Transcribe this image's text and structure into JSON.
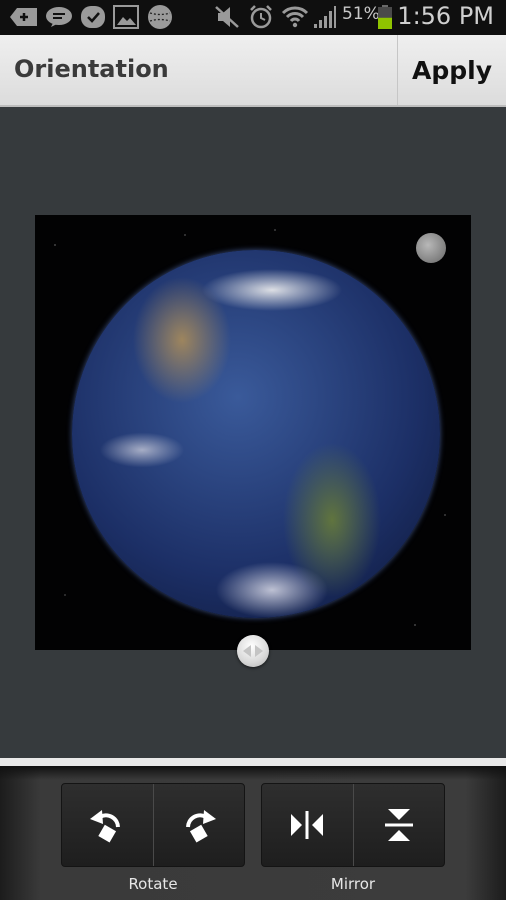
{
  "status_bar": {
    "notification_icons": [
      "add-icon",
      "chat-icon",
      "task-check-icon",
      "gallery-icon",
      "baseball-icon"
    ],
    "system_icons": [
      "mute-icon",
      "alarm-icon",
      "wifi-icon",
      "signal-icon"
    ],
    "battery_percent": "51%",
    "battery_level": 0.51,
    "battery_color": "#8fc400",
    "time": "1:56 PM"
  },
  "action_bar": {
    "title": "Orientation",
    "apply_label": "Apply"
  },
  "image": {
    "subject": "earth-photo",
    "handle_icon": "left-right-handle-icon"
  },
  "toolbar": {
    "groups": [
      {
        "label": "Rotate",
        "buttons": [
          {
            "icon": "rotate-left-icon"
          },
          {
            "icon": "rotate-right-icon"
          }
        ]
      },
      {
        "label": "Mirror",
        "buttons": [
          {
            "icon": "flip-horizontal-icon"
          },
          {
            "icon": "flip-vertical-icon"
          }
        ]
      }
    ]
  }
}
